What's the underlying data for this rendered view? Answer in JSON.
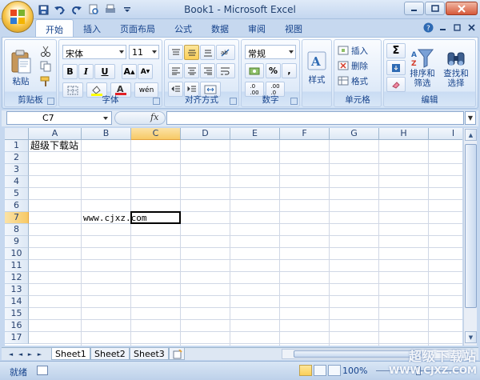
{
  "window": {
    "title": "Book1 - Microsoft Excel"
  },
  "tabs": [
    {
      "label": "开始",
      "active": true
    },
    {
      "label": "插入"
    },
    {
      "label": "页面布局"
    },
    {
      "label": "公式"
    },
    {
      "label": "数据"
    },
    {
      "label": "审阅"
    },
    {
      "label": "视图"
    }
  ],
  "ribbon": {
    "clipboard": {
      "label": "剪贴板",
      "paste": "粘贴"
    },
    "font": {
      "label": "字体",
      "family": "宋体",
      "size": "11",
      "bold": "B",
      "italic": "I",
      "underline": "U"
    },
    "alignment": {
      "label": "对齐方式"
    },
    "number": {
      "label": "数字",
      "format": "常规",
      "percent": "%",
      "comma": ","
    },
    "styles": {
      "label": "样式"
    },
    "cells": {
      "label": "单元格",
      "insert": "插入",
      "delete": "删除",
      "format": "格式"
    },
    "editing": {
      "label": "编辑",
      "sort_filter": "排序和\n筛选",
      "find_select": "查找和\n选择",
      "sort_line1": "排序和",
      "sort_line2": "筛选",
      "find_line1": "查找和",
      "find_line2": "选择"
    }
  },
  "formula_bar": {
    "name_box": "C7",
    "fx": "fx",
    "formula": ""
  },
  "grid": {
    "columns": [
      "A",
      "B",
      "C",
      "D",
      "E",
      "F",
      "G",
      "H",
      "I"
    ],
    "rows": [
      "1",
      "2",
      "3",
      "4",
      "5",
      "6",
      "7",
      "8",
      "9",
      "10",
      "11",
      "12",
      "13",
      "14",
      "15",
      "16",
      "17"
    ],
    "selected_column": "C",
    "selected_row": "7",
    "cells": {
      "A1": "超级下载站",
      "B7": "www.cjxz.com"
    }
  },
  "sheets": [
    {
      "label": "Sheet1",
      "active": true
    },
    {
      "label": "Sheet2"
    },
    {
      "label": "Sheet3"
    }
  ],
  "status": {
    "text": "就绪",
    "zoom": "100%"
  },
  "watermark": {
    "line1": "超级下载站",
    "line2": "WWW.CJXZ.COM"
  }
}
